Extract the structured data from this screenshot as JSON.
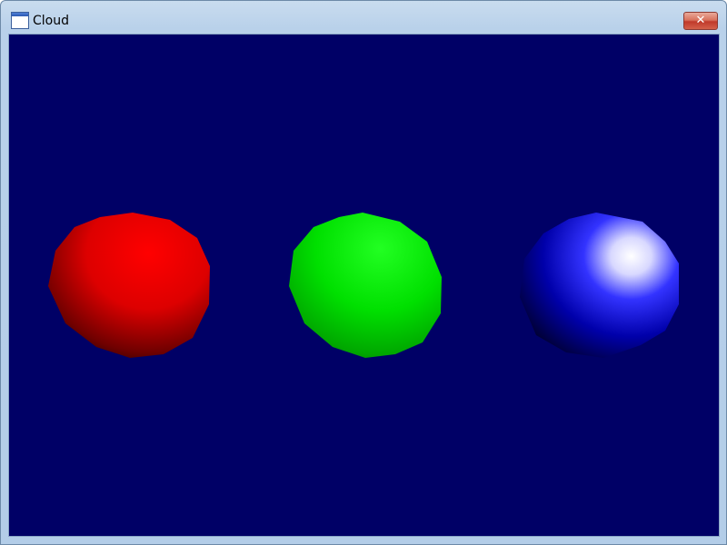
{
  "window": {
    "title": "Cloud",
    "title_icon": "app-window-icon",
    "close_icon": "close-icon",
    "close_glyph": "✕"
  },
  "scene": {
    "background_color": "#000066",
    "spheres": [
      {
        "name": "red-sphere",
        "color": "#ff0000",
        "shading": "diffuse"
      },
      {
        "name": "green-sphere",
        "color": "#00ff00",
        "shading": "diffuse"
      },
      {
        "name": "blue-sphere",
        "color": "#0000ff",
        "shading": "specular"
      }
    ]
  }
}
